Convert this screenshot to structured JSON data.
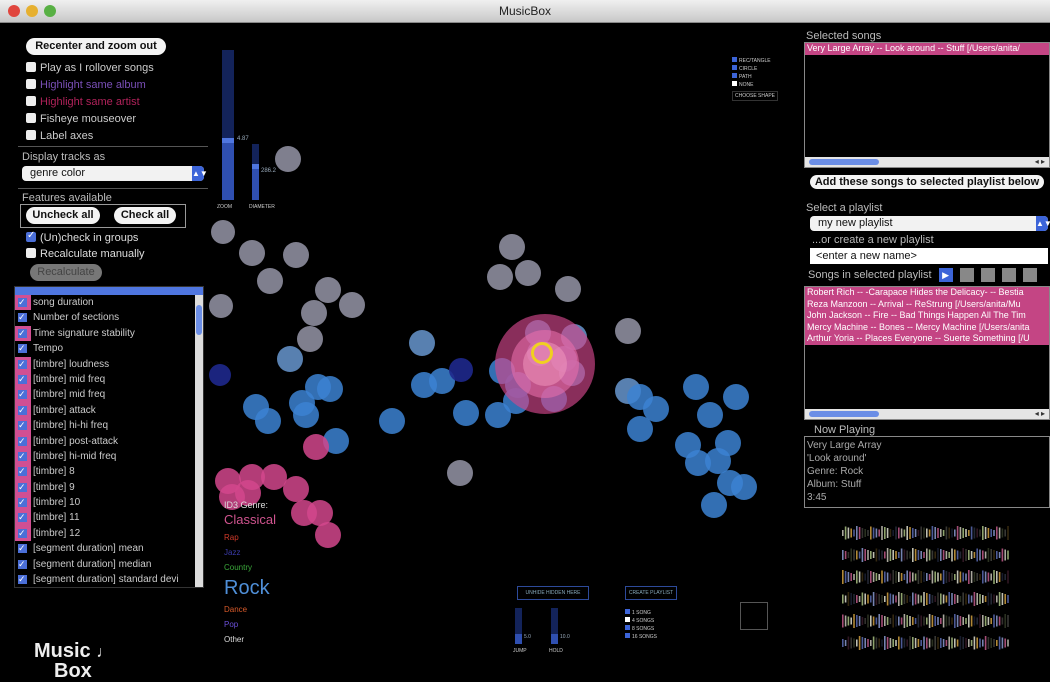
{
  "window": {
    "title": "MusicBox"
  },
  "left": {
    "recenter_label": "Recenter and zoom out",
    "options": [
      {
        "label": "Play as I rollover songs",
        "checked": false,
        "color": "#cccccc"
      },
      {
        "label": "Highlight same album",
        "checked": false,
        "color": "#7a4fb8"
      },
      {
        "label": "Highlight same artist",
        "checked": false,
        "color": "#b0225a"
      },
      {
        "label": "Fisheye mouseover",
        "checked": false,
        "color": "#cccccc"
      },
      {
        "label": "Label axes",
        "checked": false,
        "color": "#cccccc"
      }
    ],
    "display_tracks_label": "Display tracks as",
    "display_tracks_value": "genre color",
    "features_label": "Features available",
    "uncheck_all_label": "Uncheck all",
    "check_all_label": "Check all",
    "uncheck_groups_label": "(Un)check in groups",
    "recalc_label": "Recalculate manually",
    "recalc_button_label": "Recalculate",
    "features": [
      {
        "label": "song duration",
        "pink": true
      },
      {
        "label": "Number of sections",
        "pink": false
      },
      {
        "label": "Time signature stability",
        "pink": true
      },
      {
        "label": "Tempo",
        "pink": false
      },
      {
        "label": "[timbre] loudness",
        "pink": true
      },
      {
        "label": "[timbre] mid freq",
        "pink": true
      },
      {
        "label": "[timbre] mid freq",
        "pink": true
      },
      {
        "label": "[timbre] attack",
        "pink": true
      },
      {
        "label": "[timbre] hi-hi freq",
        "pink": true
      },
      {
        "label": "[timbre] post-attack",
        "pink": true
      },
      {
        "label": "[timbre] hi-mid freq",
        "pink": true
      },
      {
        "label": "[timbre] 8",
        "pink": true
      },
      {
        "label": "[timbre] 9",
        "pink": true
      },
      {
        "label": "[timbre] 10",
        "pink": true
      },
      {
        "label": "[timbre] 11",
        "pink": true
      },
      {
        "label": "[timbre] 12",
        "pink": true
      },
      {
        "label": "[segment duration] mean",
        "pink": false
      },
      {
        "label": "[segment duration] median",
        "pink": false
      },
      {
        "label": "[segment duration] standard devi",
        "pink": false
      }
    ],
    "logo_line1": "Music",
    "logo_line2": "Box"
  },
  "viz": {
    "zoom_label": "ZOOM",
    "diameter_label": "DIAMETER",
    "zoom_value": "4.87",
    "diameter_value": "286.2",
    "shape_options": [
      "REC/TANGLE",
      "CIRCLE",
      "PATH",
      "NONE"
    ],
    "shape_button": "CHOOSE SHAPE",
    "genre_title": "ID3 Genre:",
    "genres": [
      {
        "label": "Classical",
        "color": "#d0548f",
        "size": 13
      },
      {
        "label": "Rap",
        "color": "#d03a2a",
        "size": 8
      },
      {
        "label": "Jazz",
        "color": "#3a3aa8",
        "size": 8
      },
      {
        "label": "Country",
        "color": "#3aa83a",
        "size": 8
      },
      {
        "label": "Rock",
        "color": "#4f8fd8",
        "size": 20
      },
      {
        "label": "Dance",
        "color": "#d85a2a",
        "size": 8
      },
      {
        "label": "Pop",
        "color": "#6a4fd8",
        "size": 8
      },
      {
        "label": "Other",
        "color": "#dddddd",
        "size": 8
      }
    ],
    "bottom_button_1": "UNHIDE HIDDEN HERE",
    "bottom_button_2": "CREATE PLAYLIST",
    "jump_label": "JUMP",
    "hold_label": "HOLD",
    "jump_value": "5.0",
    "hold_value": "10.0",
    "song_count_options": [
      "1 SONG",
      "4 SONGS",
      "8 SONGS",
      "16 SONGS"
    ]
  },
  "right": {
    "selected_songs_label": "Selected songs",
    "selected_songs": [
      "Very Large Array -- Look around -- Stuff [/Users/anita/"
    ],
    "add_button_label": "Add these songs to selected playlist below",
    "select_playlist_label": "Select a playlist",
    "playlist_value": "my new playlist",
    "create_playlist_label": "...or create a new playlist",
    "new_name_placeholder": "<enter a new name>",
    "songs_in_playlist_label": "Songs in selected playlist",
    "playlist_songs": [
      "Robert Rich -- -Carapace Hides the Delicacy- -- Bestia",
      "Reza Manzoon -- Arrival -- ReStrung [/Users/anita/Mu",
      "John Jackson -- Fire -- Bad Things Happen All The Tim",
      "Mercy Machine -- Bones -- Mercy Machine [/Users/anita",
      "Arthur Yoria -- Places Everyone -- Suerte Something [/U"
    ],
    "now_playing_label": "Now Playing",
    "now_playing_lines": [
      "Very Large Array",
      "'Look around'",
      "Genre: Rock",
      "Album: Stuff",
      "3:45"
    ]
  },
  "colors": {
    "accent_blue": "#3c64d8",
    "rock_blue": "#4f8fd8",
    "classical_pink": "#d0548f",
    "grey_dot": "#9a9aa8",
    "highlight_yellow": "#f0d020"
  }
}
